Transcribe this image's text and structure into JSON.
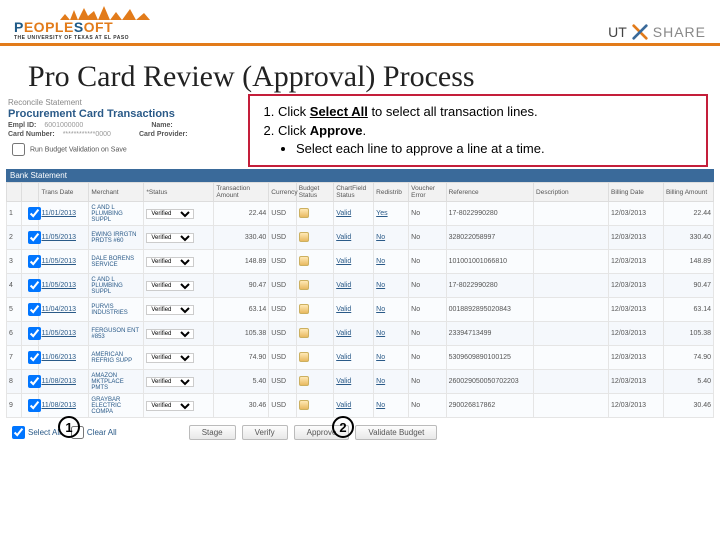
{
  "brand": {
    "peoplesoft_p": "P",
    "peoplesoft_eople": "EOPLE",
    "peoplesoft_s": "S",
    "peoplesoft_oft": "OFT",
    "peoplesoft_sub": "THE UNIVERSITY OF TEXAS AT EL PASO",
    "ut": "UT",
    "share": "SHARE"
  },
  "title": "Pro Card Review (Approval) Process",
  "reconcile_label": "Reconcile Statement",
  "proc_title": "Procurement Card Transactions",
  "meta": {
    "emplid_lbl": "Empl ID:",
    "emplid_val": "6001000000",
    "name_lbl": "Name:",
    "card_lbl": "Card Number:",
    "card_val": "************0000",
    "provider_lbl": "Card Provider:",
    "budget_lbl": "Run Budget Validation on Save"
  },
  "instr": {
    "s1a": "Click ",
    "s1b": "Select All",
    "s1c": " to select all transaction lines.",
    "s2a": "Click ",
    "s2b": "Approve",
    "s2c": ".",
    "s2bullet": "Select each line to approve a line at a time."
  },
  "bank_header": "Bank Statement",
  "cols": {
    "n": "",
    "cb": "",
    "trans": "Trans Date",
    "merchant": "Merchant",
    "status": "*Status",
    "amt": "Transaction Amount",
    "cur": "Currency",
    "budget": "Budget Status",
    "cf": "ChartField Status",
    "redist": "Redistrib",
    "voucher": "Voucher Error",
    "ref": "Reference",
    "desc": "Description",
    "bdate": "Billing Date",
    "bamt": "Billing Amount"
  },
  "rows": [
    {
      "n": "1",
      "date": "11/01/2013",
      "merchant": "C AND L PLUMBING SUPPL",
      "status": "Verified",
      "amt": "22.44",
      "cur": "USD",
      "valid": "Valid",
      "redist": "Yes",
      "ve": "No",
      "ref": "17-8022990280",
      "bdate": "12/03/2013",
      "bamt": "22.44"
    },
    {
      "n": "2",
      "date": "11/05/2013",
      "merchant": "EWING IRRGTN PRDTS #60",
      "status": "Verified",
      "amt": "330.40",
      "cur": "USD",
      "valid": "Valid",
      "redist": "No",
      "ve": "No",
      "ref": "328022058997",
      "bdate": "12/03/2013",
      "bamt": "330.40"
    },
    {
      "n": "3",
      "date": "11/05/2013",
      "merchant": "DALE BORENS SERVICE",
      "status": "Verified",
      "amt": "148.89",
      "cur": "USD",
      "valid": "Valid",
      "redist": "No",
      "ve": "No",
      "ref": "101001001066810",
      "bdate": "12/03/2013",
      "bamt": "148.89"
    },
    {
      "n": "4",
      "date": "11/05/2013",
      "merchant": "C AND L PLUMBING SUPPL",
      "status": "Verified",
      "amt": "90.47",
      "cur": "USD",
      "valid": "Valid",
      "redist": "No",
      "ve": "No",
      "ref": "17-8022990280",
      "bdate": "12/03/2013",
      "bamt": "90.47"
    },
    {
      "n": "5",
      "date": "11/04/2013",
      "merchant": "PURVIS INDUSTRIES",
      "status": "Verified",
      "amt": "63.14",
      "cur": "USD",
      "valid": "Valid",
      "redist": "No",
      "ve": "No",
      "ref": "0018892895020843",
      "bdate": "12/03/2013",
      "bamt": "63.14"
    },
    {
      "n": "6",
      "date": "11/05/2013",
      "merchant": "FERGUSON ENT #853",
      "status": "Verified",
      "amt": "105.38",
      "cur": "USD",
      "valid": "Valid",
      "redist": "No",
      "ve": "No",
      "ref": "23394713499",
      "bdate": "12/03/2013",
      "bamt": "105.38"
    },
    {
      "n": "7",
      "date": "11/06/2013",
      "merchant": "AMERICAN REFRIG SUPP",
      "status": "Verified",
      "amt": "74.90",
      "cur": "USD",
      "valid": "Valid",
      "redist": "No",
      "ve": "No",
      "ref": "5309609890100125",
      "bdate": "12/03/2013",
      "bamt": "74.90"
    },
    {
      "n": "8",
      "date": "11/08/2013",
      "merchant": "AMAZON MKTPLACE PMTS",
      "status": "Verified",
      "amt": "5.40",
      "cur": "USD",
      "valid": "Valid",
      "redist": "No",
      "ve": "No",
      "ref": "260029050050702203",
      "bdate": "12/03/2013",
      "bamt": "5.40"
    },
    {
      "n": "9",
      "date": "11/08/2013",
      "merchant": "GRAYBAR ELECTRIC COMPA",
      "status": "Verified",
      "amt": "30.46",
      "cur": "USD",
      "valid": "Valid",
      "redist": "No",
      "ve": "No",
      "ref": "290026817862",
      "bdate": "12/03/2013",
      "bamt": "30.46"
    }
  ],
  "actions": {
    "select_all": "Select All",
    "clear_all": "Clear All",
    "stage": "Stage",
    "verify": "Verify",
    "approve": "Approve",
    "validate": "Validate Budget"
  },
  "callouts": {
    "one": "1",
    "two": "2"
  }
}
